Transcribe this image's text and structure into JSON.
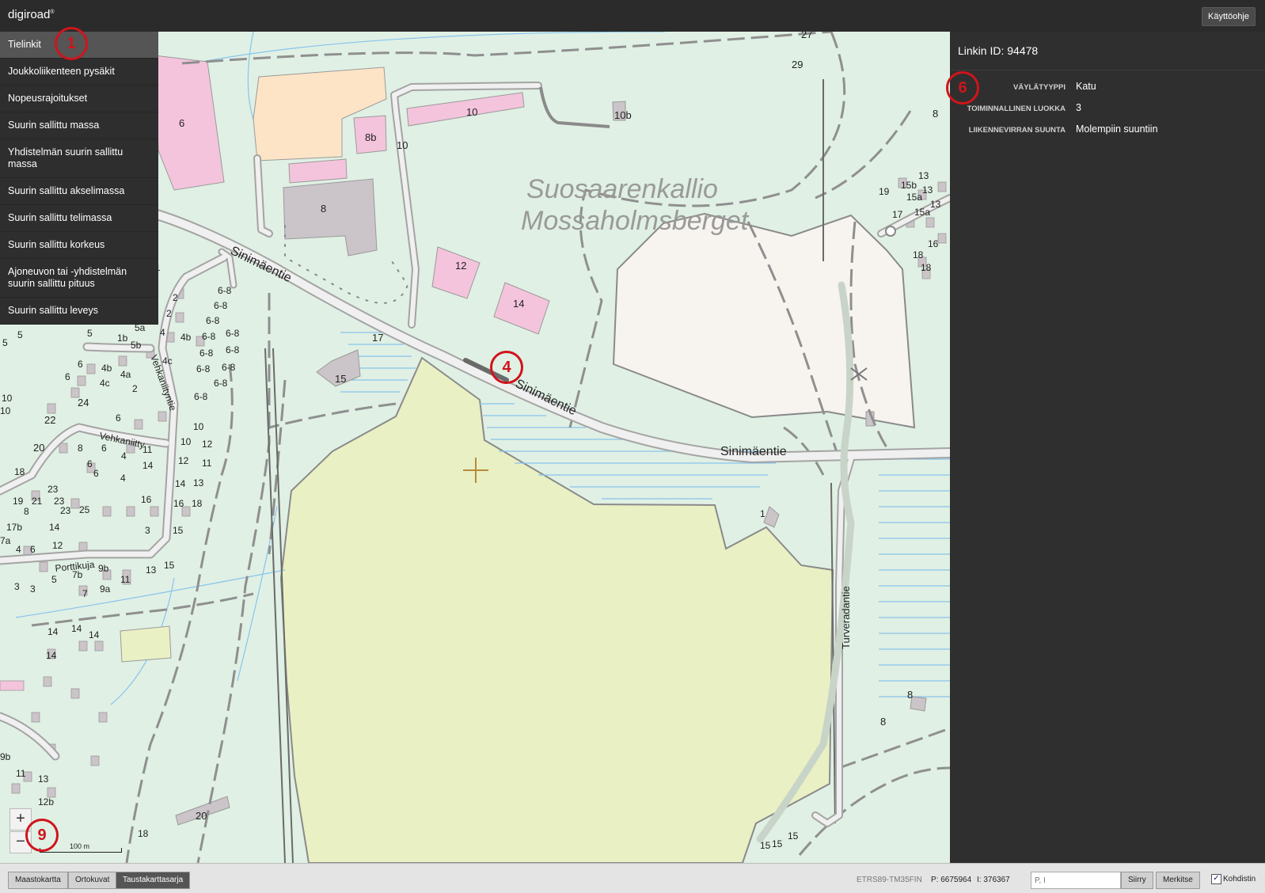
{
  "app": {
    "logo": "digiroad",
    "logo_mark": "®",
    "help_button": "Käyttöohje"
  },
  "layer_menu": {
    "items": [
      {
        "label": "Tielinkit",
        "active": true
      },
      {
        "label": "Joukkoliikenteen pysäkit"
      },
      {
        "label": "Nopeusrajoitukset"
      },
      {
        "label": "Suurin sallittu massa"
      },
      {
        "label": "Yhdistelmän suurin sallittu massa"
      },
      {
        "label": "Suurin sallittu akselimassa"
      },
      {
        "label": "Suurin sallittu telimassa"
      },
      {
        "label": "Suurin sallittu korkeus"
      },
      {
        "label": "Ajoneuvon tai -yhdistelmän suurin sallittu pituus"
      },
      {
        "label": "Suurin sallittu leveys"
      }
    ]
  },
  "side_panel": {
    "link_id": "Linkin ID: 94478",
    "properties": [
      {
        "label": "VÄYLÄTYYPPI",
        "value": "Katu"
      },
      {
        "label": "TOIMINNALLINEN LUOKKA",
        "value": "3"
      },
      {
        "label": "LIIKENNEVIRRAN SUUNTA",
        "value": "Molempiin suuntiin"
      }
    ]
  },
  "map": {
    "place_names": [
      "Suosaarenkallio",
      "Mossaholmsberget"
    ],
    "street_names": [
      "Sinimäentie",
      "Sinimäentie",
      "Sinimäentie",
      "Vehkaniityntie",
      "Vehkaniitty",
      "Porttikuja",
      "Turveradantie"
    ],
    "house_numbers": [
      "6",
      "8",
      "8b",
      "10",
      "10",
      "10b",
      "12",
      "14",
      "15",
      "17",
      "27",
      "29",
      "8",
      "13",
      "15b",
      "15a",
      "15a",
      "13",
      "13",
      "19",
      "17",
      "18",
      "16",
      "18",
      "1",
      "8",
      "8",
      "20",
      "18",
      "15",
      "15",
      "15",
      "6-8",
      "6-8",
      "6-8",
      "6-8",
      "6-8",
      "6-8",
      "6-8",
      "6-8",
      "6-8",
      "6-8",
      "6-8",
      "2",
      "2",
      "4",
      "4b",
      "4c",
      "4b",
      "4a",
      "4c",
      "2",
      "6",
      "6",
      "5",
      "5",
      "1b",
      "5b",
      "5a",
      "1",
      "24",
      "22",
      "20",
      "18",
      "19",
      "21",
      "23",
      "23",
      "23",
      "25",
      "17b",
      "8",
      "14",
      "12",
      "7a",
      "4",
      "6",
      "3",
      "3",
      "5",
      "7b",
      "7",
      "9b",
      "9a",
      "11",
      "13",
      "15",
      "14",
      "14",
      "14",
      "14",
      "9b",
      "11",
      "13",
      "12b",
      "10",
      "10",
      "10",
      "10",
      "12",
      "12",
      "11",
      "11",
      "14",
      "14",
      "13",
      "16",
      "16",
      "18",
      "15",
      "3",
      "5",
      "6",
      "8",
      "6",
      "6",
      "4",
      "4",
      "6"
    ],
    "marker_labels": [
      "1",
      "4",
      "6",
      "9"
    ],
    "zoom_in": "+",
    "zoom_out": "−",
    "scale_label": "100 m"
  },
  "bottom_bar": {
    "background_buttons": [
      {
        "label": "Maastokartta"
      },
      {
        "label": "Ortokuvat"
      },
      {
        "label": "Taustakarttasarja",
        "active": true
      }
    ],
    "crs": "ETRS89-TM35FIN",
    "coord_p": "P: 6675964",
    "coord_i": "I: 376367",
    "coord_input_placeholder": "P, I",
    "go_button": "Siirry",
    "mark_button": "Merkitse",
    "crosshair_checkbox": "✓",
    "crosshair_label": "Kohdistin"
  },
  "colors": {
    "map_background": "#e0f0e4",
    "forest_area": "#e9f0c4",
    "rock_area": "#f7f4f0",
    "building_pink": "#f4c4dc",
    "building_grey": "#cbc4c8",
    "building_orange": "#fde4c6",
    "water_line": "#88c4ec",
    "road_fill": "#f0f0f0",
    "road_casing": "#a4a4a4",
    "marker_red": "#d0141c",
    "panel_dark": "#2f2f2f"
  }
}
